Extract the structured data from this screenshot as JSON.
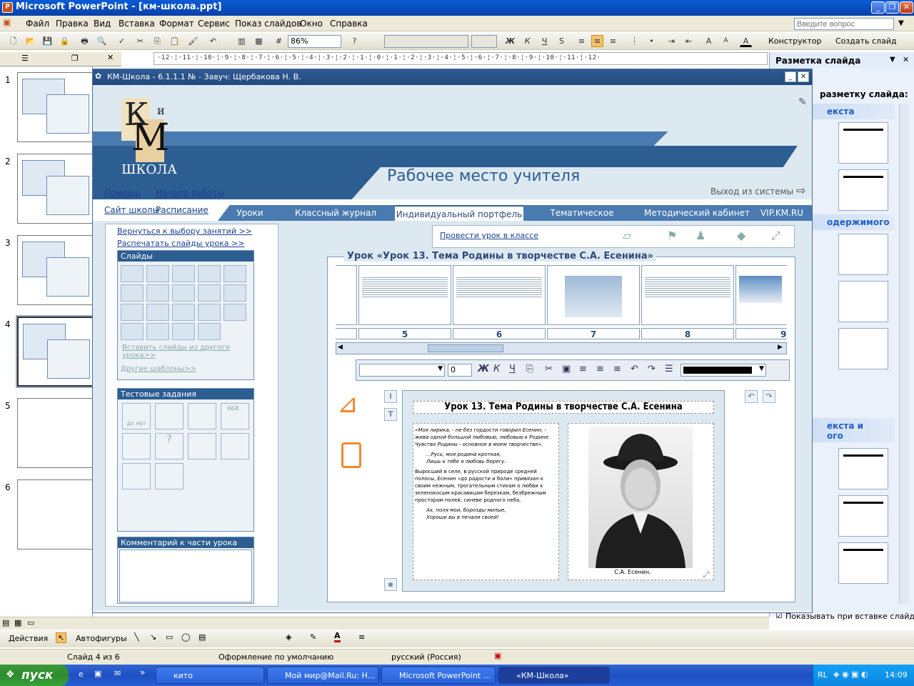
{
  "ppt": {
    "title": "Microsoft PowerPoint - [км-школа.ppt]",
    "menu": [
      "Файл",
      "Правка",
      "Вид",
      "Вставка",
      "Формат",
      "Сервис",
      "Показ слайдов",
      "Окно",
      "Справка"
    ],
    "help_placeholder": "Введите вопрос",
    "zoom": "86%",
    "designer": "Конструктор",
    "create_slide": "Создать слайд",
    "ruler": "·12·¦·11·¦·10·¦·9·¦·8·¦·7·¦·6·¦·5·¦·4·¦·3·¦·2·¦·1·¦·0·¦·1·¦·2·¦·3·¦·4·¦·5·¦·6·¦·7·¦·8·¦·9·¦·10·¦·11·¦·12·",
    "slide_numbers": [
      "1",
      "2",
      "3",
      "4",
      "5",
      "6"
    ],
    "taskpane": {
      "title": "Разметка слайда",
      "subtitle": "разметку слайда:",
      "section1": "екста",
      "section2": "одержимого",
      "section3": "екста и",
      "section3b": "ого",
      "show_on_insert": "Показывать при вставке слайдов"
    },
    "drawing": {
      "actions": "Действия",
      "autoshapes": "Автофигуры"
    },
    "status": {
      "slide": "Слайд 4 из 6",
      "design": "Оформление по умолчанию",
      "lang": "русский (Россия)"
    }
  },
  "taskbar": {
    "start": "пуск",
    "items": [
      "кито",
      "Мой мир@Mail.Ru: Н...",
      "Microsoft PowerPoint ...",
      "«КМ-Школа»"
    ],
    "lang": "RL",
    "time": "14:09"
  },
  "km": {
    "window_title": "КМ-Школа - 6.1.1.1  №  -  Завуч: Щербакова Н. В.",
    "logo": {
      "top": "К",
      "mid": "и",
      "big": "М",
      "bottom": "ШКОЛА"
    },
    "heading": "Рабочее место учителя",
    "exit": "Выход из системы",
    "links": {
      "help": "Помощь",
      "home": "Начало работы",
      "site": "Сайт школы",
      "schedule": "Расписание"
    },
    "tabs": [
      "Уроки",
      "Классный журнал",
      "Индивидуальный портфель",
      "Тематическое планирование",
      "Методический кабинет",
      "VIP.KM.RU"
    ],
    "left": {
      "back": "Вернуться к выбору занятий >>",
      "print": "Распечатать слайды урока >>",
      "slides_header": "Слайды",
      "insert_other": "Вставить слайды из другого урока>>",
      "other_templates": "Другие шаблоны>>",
      "tests_header": "Тестовые задания",
      "test_labels": [
        "ДА НЕТ",
        "АБВ"
      ],
      "comment_header": "Комментарий к части урока"
    },
    "conduct": "Провести урок в классе",
    "lesson_title": "Урок «Урок 13. Тема Родины в творчестве С.А. Есенина»",
    "strip_numbers": [
      "5",
      "6",
      "7",
      "8",
      "9"
    ],
    "format": {
      "size": "0"
    },
    "editor": {
      "title": "Урок 13. Тема Родины в творчестве С.А. Есенина",
      "p1": "«Моя лирика, - не без гордости говорил Есенин, - жива одной большой любовью, любовью к Родине. Чувство Родины - основное в моем творчестве».",
      "p2a": "...Русь, моя родина кроткая,",
      "p2b": "Лишь к тебе я любовь берегу.",
      "p3": "Выросший в селе, в русской природе средней полосы, Есенин «до радости и боли» привязан к своим нежным, трогательным стихам о любви к зеленокосым красавицам березкам, безбрежным просторам полей, синеве родного неба.",
      "p4a": "Ах, поля мои, борозды милые,",
      "p4b": "Хороши вы в печали своей!",
      "caption": "С.А. Есенин."
    }
  },
  "colors": {
    "km_blue": "#2d5e92",
    "km_light": "#dde9f0",
    "xp_blue": "#0a5bd6"
  }
}
